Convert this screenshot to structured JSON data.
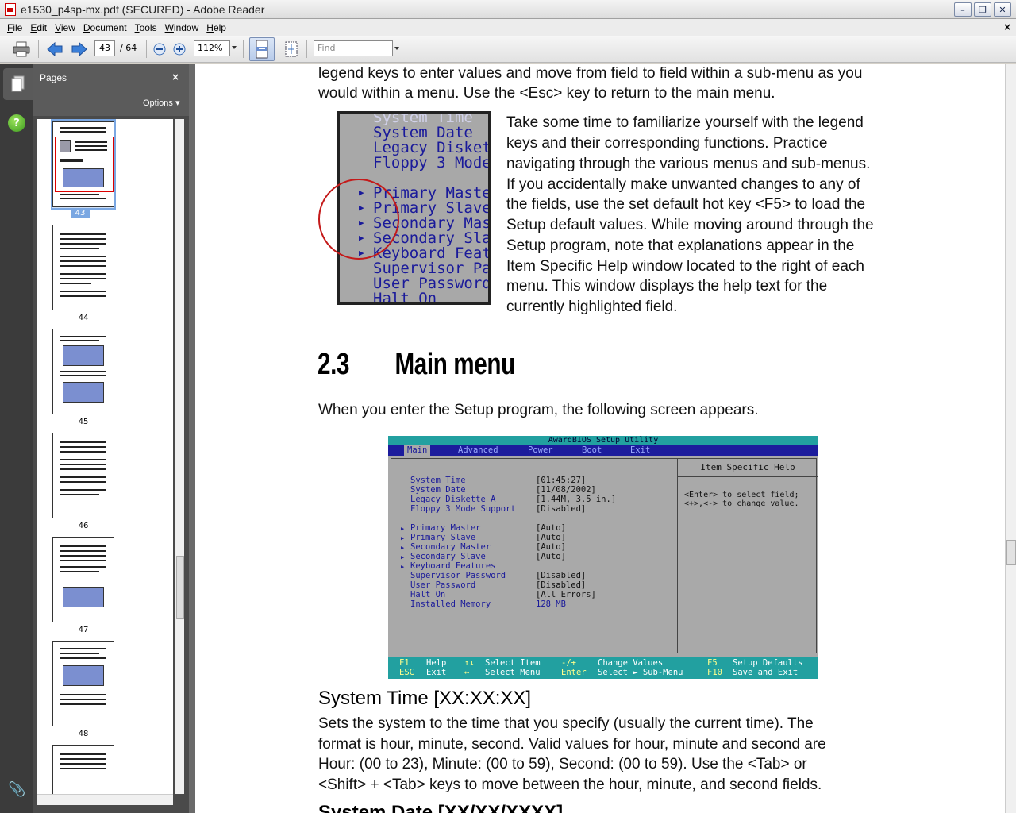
{
  "window": {
    "title": "e1530_p4sp-mx.pdf (SECURED) - Adobe Reader",
    "buttons": [
      "minimize",
      "restore",
      "close"
    ]
  },
  "menubar": {
    "items": [
      "File",
      "Edit",
      "View",
      "Document",
      "Tools",
      "Window",
      "Help"
    ],
    "close_doc": "×"
  },
  "toolbar": {
    "current_page": "43",
    "total_pages": "/ 64",
    "zoom": "112%",
    "find_placeholder": "Find",
    "icons": [
      "print-icon",
      "previous-page-icon",
      "next-page-icon",
      "zoom-out-icon",
      "zoom-in-icon",
      "fit-page-icon",
      "fit-width-icon"
    ]
  },
  "sidebar": {
    "title": "Pages",
    "close": "×",
    "options": "Options",
    "thumbnails": [
      {
        "label": "43",
        "selected": true
      },
      {
        "label": "44",
        "selected": false
      },
      {
        "label": "45",
        "selected": false
      },
      {
        "label": "46",
        "selected": false
      },
      {
        "label": "47",
        "selected": false
      },
      {
        "label": "48",
        "selected": false
      }
    ],
    "help": "?"
  },
  "document": {
    "intro_line1": "legend keys to enter values and move from field to field within a sub-menu as you",
    "intro_line2": "would within a menu. Use the <Esc> key to return to the main menu.",
    "para_lines": [
      "Take some time to familiarize yourself with the legend",
      "keys and their corresponding functions. Practice",
      "navigating through the various menus and sub-menus.",
      "If you accidentally make unwanted changes to any of",
      "the fields, use the set default hot key <F5> to load the",
      "Setup default values. While moving around through the",
      "Setup program, note that explanations appear in the",
      "Item Specific Help window located to the right of each",
      "menu. This window displays the help text for the",
      "currently highlighted field."
    ],
    "zoom_rows": [
      "System Time",
      "System Date",
      "Legacy Diskett",
      "Floppy 3 Mode",
      "Primary Master",
      "Primary Slave",
      "Secondary Mast",
      "Secondary Slav",
      "Keyboard Featu",
      "Supervisor Pas",
      "User Password",
      "Halt On"
    ],
    "section_number": "2.3",
    "section_title": "Main menu",
    "section_intro": "When you enter the Setup program, the following screen appears.",
    "bios": {
      "title": "AwardBIOS Setup Utility",
      "tabs": [
        "Main",
        "Advanced",
        "Power",
        "Boot",
        "Exit"
      ],
      "items": [
        {
          "label": "System Time",
          "value": "[01:45:27]"
        },
        {
          "label": "System Date",
          "value": "[11/08/2002]"
        },
        {
          "label": "Legacy Diskette A",
          "value": "[1.44M, 3.5 in.]"
        },
        {
          "label": "Floppy 3 Mode Support",
          "value": "[Disabled]"
        },
        {
          "label": "Primary Master",
          "value": "[Auto]"
        },
        {
          "label": "Primary Slave",
          "value": "[Auto]"
        },
        {
          "label": "Secondary Master",
          "value": "[Auto]"
        },
        {
          "label": "Secondary Slave",
          "value": "[Auto]"
        },
        {
          "label": "Keyboard Features",
          "value": ""
        },
        {
          "label": "Supervisor Password",
          "value": "[Disabled]"
        },
        {
          "label": "User Password",
          "value": "[Disabled]"
        },
        {
          "label": "Halt On",
          "value": "[All Errors]"
        },
        {
          "label": "Installed Memory",
          "value": "128 MB"
        }
      ],
      "help_title": "Item Specific Help",
      "help_line1": "<Enter> to select field;",
      "help_line2": "<+>,<-> to change value.",
      "footer_row1": [
        "F1",
        "Help",
        "↑↓",
        "Select Item",
        "-/+",
        "Change Values",
        "F5",
        "Setup Defaults"
      ],
      "footer_row2": [
        "ESC",
        "Exit",
        "↔",
        "Select Menu",
        "Enter",
        "Select ► Sub-Menu",
        "F10",
        "Save and Exit"
      ]
    },
    "subsection_title": "System Time [XX:XX:XX]",
    "subsection_lines": [
      "Sets the system to the time that you specify (usually the current time). The",
      "format is hour, minute, second. Valid values for hour, minute and second are",
      "Hour: (00 to 23), Minute: (00 to 59), Second: (00 to 59). Use the <Tab> or",
      "<Shift> + <Tab> keys to move between the hour, minute, and second fields."
    ],
    "next_subsection_title": "System Date [XX/XX/XXXX]"
  }
}
